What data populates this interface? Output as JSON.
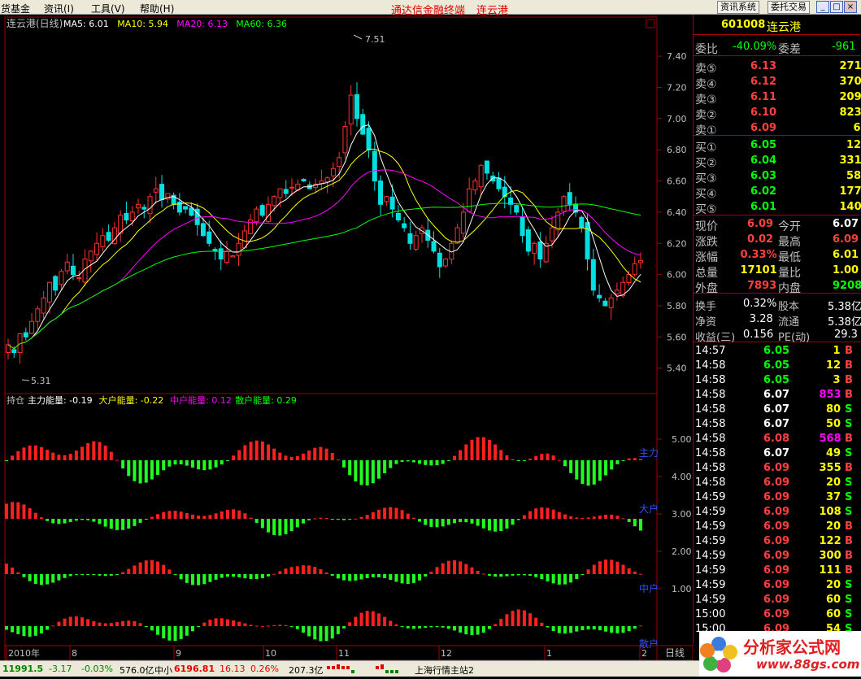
{
  "menubar": {
    "items": [
      "货基金",
      "资讯(I)",
      "工具(V)",
      "帮助(H)"
    ],
    "title": "通达信金融终端",
    "stock_title": "连云港",
    "buttons": [
      "资讯系统",
      "委托交易"
    ]
  },
  "chart_data": {
    "type": "candlestick",
    "title": "连云港(日线)",
    "ma_legend": [
      {
        "label": "MA5: 6.01",
        "color": "#ffffff"
      },
      {
        "label": "MA10: 5.94",
        "color": "#ffff00"
      },
      {
        "label": "MA20: 6.13",
        "color": "#ff00ff"
      },
      {
        "label": "MA60: 6.36",
        "color": "#00ff00"
      }
    ],
    "price_ticks": [
      "7.40",
      "7.20",
      "7.00",
      "6.80",
      "6.60",
      "6.40",
      "6.20",
      "6.00",
      "5.80",
      "5.60",
      "5.40"
    ],
    "ylim": [
      5.3,
      7.55
    ],
    "high_marker": "7.51",
    "low_marker": "5.31",
    "closes": [
      5.55,
      5.5,
      5.62,
      5.6,
      5.7,
      5.78,
      5.85,
      5.95,
      5.9,
      6.02,
      6.08,
      6.0,
      5.98,
      6.1,
      6.15,
      6.2,
      6.25,
      6.22,
      6.3,
      6.38,
      6.35,
      6.4,
      6.45,
      6.42,
      6.5,
      6.55,
      6.48,
      6.52,
      6.45,
      6.4,
      6.42,
      6.38,
      6.32,
      6.25,
      6.2,
      6.15,
      6.1,
      6.15,
      6.12,
      6.2,
      6.28,
      6.35,
      6.42,
      6.38,
      6.45,
      6.5,
      6.55,
      6.52,
      6.56,
      6.58,
      6.6,
      6.55,
      6.58,
      6.6,
      6.62,
      6.68,
      6.75,
      6.95,
      7.15,
      7.0,
      6.9,
      6.8,
      6.6,
      6.45,
      6.5,
      6.42,
      6.35,
      6.3,
      6.2,
      6.25,
      6.3,
      6.22,
      6.15,
      6.05,
      6.1,
      6.2,
      6.3,
      6.4,
      6.55,
      6.6,
      6.7,
      6.65,
      6.6,
      6.55,
      6.5,
      6.45,
      6.4,
      6.25,
      6.15,
      6.2,
      6.1,
      6.2,
      6.3,
      6.4,
      6.5,
      6.45,
      6.4,
      6.3,
      6.1,
      5.9,
      5.85,
      5.8,
      5.85,
      5.9,
      5.95,
      6.0,
      6.07,
      6.09
    ],
    "indicator_title": "持仓",
    "indicator_legend": [
      {
        "label": "主力能量: -0.19",
        "color": "#ffffff"
      },
      {
        "label": "大户能量: -0.22",
        "color": "#ffff00"
      },
      {
        "label": "中户能量: 0.12",
        "color": "#ff00ff"
      },
      {
        "label": "散户能量: 0.29",
        "color": "#00ff00"
      }
    ],
    "indicator_ticks": [
      "5.00",
      "4.00",
      "3.00",
      "2.00",
      "1.00"
    ],
    "indicator_labels": [
      "主力",
      "大户",
      "中户",
      "散户"
    ],
    "x_labels": [
      "2010年",
      "8",
      "9",
      "10",
      "11",
      "12",
      "1",
      "2"
    ],
    "period": "日线"
  },
  "quote": {
    "code": "601008",
    "name": "连云港",
    "weibi": {
      "label": "委比",
      "value": "-40.09%",
      "diff_label": "委差",
      "diff": "-961"
    },
    "asks": [
      {
        "label": "卖⑤",
        "price": "6.13",
        "vol": "271"
      },
      {
        "label": "卖④",
        "price": "6.12",
        "vol": "370"
      },
      {
        "label": "卖③",
        "price": "6.11",
        "vol": "209"
      },
      {
        "label": "卖②",
        "price": "6.10",
        "vol": "823"
      },
      {
        "label": "卖①",
        "price": "6.09",
        "vol": "6"
      }
    ],
    "bids": [
      {
        "label": "买①",
        "price": "6.05",
        "vol": "12"
      },
      {
        "label": "买②",
        "price": "6.04",
        "vol": "331"
      },
      {
        "label": "买③",
        "price": "6.03",
        "vol": "58"
      },
      {
        "label": "买④",
        "price": "6.02",
        "vol": "177"
      },
      {
        "label": "买⑤",
        "price": "6.01",
        "vol": "140"
      }
    ],
    "stats": [
      {
        "l1": "现价",
        "v1": "6.09",
        "c1": "#ff4040",
        "l2": "今开",
        "v2": "6.07",
        "c2": "#ffffff"
      },
      {
        "l1": "涨跌",
        "v1": "0.02",
        "c1": "#ff4040",
        "l2": "最高",
        "v2": "6.09",
        "c2": "#ff4040"
      },
      {
        "l1": "涨幅",
        "v1": "0.33%",
        "c1": "#ff4040",
        "l2": "最低",
        "v2": "6.01",
        "c2": "#ffff00"
      },
      {
        "l1": "总量",
        "v1": "17101",
        "c1": "#ffff00",
        "l2": "量比",
        "v2": "1.00",
        "c2": "#ffff00"
      },
      {
        "l1": "外盘",
        "v1": "7893",
        "c1": "#ff4040",
        "l2": "内盘",
        "v2": "9208",
        "c2": "#00ff00"
      }
    ],
    "stats2": [
      {
        "l1": "换手",
        "v1": "0.32%",
        "l2": "股本",
        "v2": "5.38亿"
      },
      {
        "l1": "净资",
        "v1": "3.28",
        "l2": "流通",
        "v2": "5.38亿"
      },
      {
        "l1": "收益(三)",
        "v1": "0.156",
        "l2": "PE(动)",
        "v2": "29.3"
      }
    ]
  },
  "ticks": [
    {
      "t": "14:57",
      "p": "6.05",
      "pc": "#00ff00",
      "v": "1",
      "vc": "#ffff00",
      "f": "B"
    },
    {
      "t": "14:58",
      "p": "6.05",
      "pc": "#00ff00",
      "v": "12",
      "vc": "#ffff00",
      "f": "B"
    },
    {
      "t": "14:58",
      "p": "6.05",
      "pc": "#00ff00",
      "v": "3",
      "vc": "#ffff00",
      "f": "B"
    },
    {
      "t": "14:58",
      "p": "6.07",
      "pc": "#ffffff",
      "v": "853",
      "vc": "#ff00ff",
      "f": "B"
    },
    {
      "t": "14:58",
      "p": "6.07",
      "pc": "#ffffff",
      "v": "80",
      "vc": "#ffff00",
      "f": "S"
    },
    {
      "t": "14:58",
      "p": "6.07",
      "pc": "#ffffff",
      "v": "50",
      "vc": "#ffff00",
      "f": "S"
    },
    {
      "t": "14:58",
      "p": "6.08",
      "pc": "#ff4040",
      "v": "568",
      "vc": "#ff00ff",
      "f": "B"
    },
    {
      "t": "14:58",
      "p": "6.07",
      "pc": "#ffffff",
      "v": "49",
      "vc": "#ffff00",
      "f": "S"
    },
    {
      "t": "14:58",
      "p": "6.09",
      "pc": "#ff4040",
      "v": "355",
      "vc": "#ffff00",
      "f": "B"
    },
    {
      "t": "14:58",
      "p": "6.09",
      "pc": "#ff4040",
      "v": "20",
      "vc": "#ffff00",
      "f": "S"
    },
    {
      "t": "14:59",
      "p": "6.09",
      "pc": "#ff4040",
      "v": "37",
      "vc": "#ffff00",
      "f": "S"
    },
    {
      "t": "14:59",
      "p": "6.09",
      "pc": "#ff4040",
      "v": "108",
      "vc": "#ffff00",
      "f": "S"
    },
    {
      "t": "14:59",
      "p": "6.09",
      "pc": "#ff4040",
      "v": "20",
      "vc": "#ffff00",
      "f": "B"
    },
    {
      "t": "14:59",
      "p": "6.09",
      "pc": "#ff4040",
      "v": "122",
      "vc": "#ffff00",
      "f": "B"
    },
    {
      "t": "14:59",
      "p": "6.09",
      "pc": "#ff4040",
      "v": "300",
      "vc": "#ffff00",
      "f": "B"
    },
    {
      "t": "14:59",
      "p": "6.09",
      "pc": "#ff4040",
      "v": "111",
      "vc": "#ffff00",
      "f": "B"
    },
    {
      "t": "14:59",
      "p": "6.09",
      "pc": "#ff4040",
      "v": "20",
      "vc": "#ffff00",
      "f": "S"
    },
    {
      "t": "14:59",
      "p": "6.09",
      "pc": "#ff4040",
      "v": "60",
      "vc": "#ffff00",
      "f": "S"
    },
    {
      "t": "15:00",
      "p": "6.09",
      "pc": "#ff4040",
      "v": "60",
      "vc": "#ffff00",
      "f": "S"
    },
    {
      "t": "15:00",
      "p": "6.09",
      "pc": "#ff4040",
      "v": "54",
      "vc": "#ffff00",
      "f": "S"
    }
  ],
  "status": {
    "idx1": "11991.5",
    "idx1_chg": "-3.17",
    "idx1_pct": "-0.03%",
    "idx1_amt": "576.0亿",
    "idx2_name": "中小",
    "idx2": "6196.81",
    "idx2_chg": "16.13",
    "idx2_pct": "0.26%",
    "idx2_amt": "207.3亿",
    "server": "上海行情主站2"
  },
  "logo": {
    "text": "分析家公式网",
    "url": "www.88gs.com"
  }
}
